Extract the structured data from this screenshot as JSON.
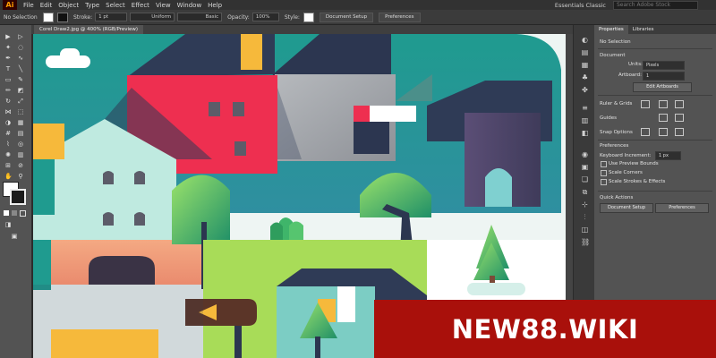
{
  "app": {
    "logo": "Ai"
  },
  "menu": [
    "File",
    "Edit",
    "Object",
    "Type",
    "Select",
    "Effect",
    "View",
    "Window",
    "Help"
  ],
  "workspace": "Essentials Classic",
  "search_placeholder": "Search Adobe Stock",
  "control": {
    "selection": "No Selection",
    "stroke_label": "Stroke:",
    "stroke_value": "1 pt",
    "profile": "Uniform",
    "brush": "Basic",
    "opacity_label": "Opacity:",
    "opacity_value": "100%",
    "style_label": "Style:",
    "document_setup": "Document Setup",
    "preferences": "Preferences"
  },
  "document_tab": "Corel Draw2.jpg @ 400% (RGB/Preview)",
  "properties": {
    "tabs": [
      "Properties",
      "Libraries"
    ],
    "no_selection": "No Selection",
    "document_title": "Document",
    "units_label": "Units:",
    "units_value": "Pixels",
    "artboard_label": "Artboard:",
    "artboard_value": "1",
    "edit_artboards": "Edit Artboards",
    "rulers_grids": "Ruler & Grids",
    "guides": "Guides",
    "snap_options": "Snap Options",
    "preferences_title": "Preferences",
    "keyboard_increment_label": "Keyboard Increment:",
    "keyboard_increment_value": "1 px",
    "use_preview_bounds": "Use Preview Bounds",
    "scale_corners": "Scale Corners",
    "scale_strokes": "Scale Strokes & Effects",
    "quick_actions": "Quick Actions",
    "qa_document_setup": "Document Setup",
    "qa_preferences": "Preferences"
  },
  "watermark": "NEW88.WIKI",
  "colors": {
    "accent": "#ff9a00",
    "watermark_bg": "#a9100b",
    "teal": "#1f9b8f",
    "crimson": "#ee2f50",
    "navy": "#2f3b56"
  }
}
